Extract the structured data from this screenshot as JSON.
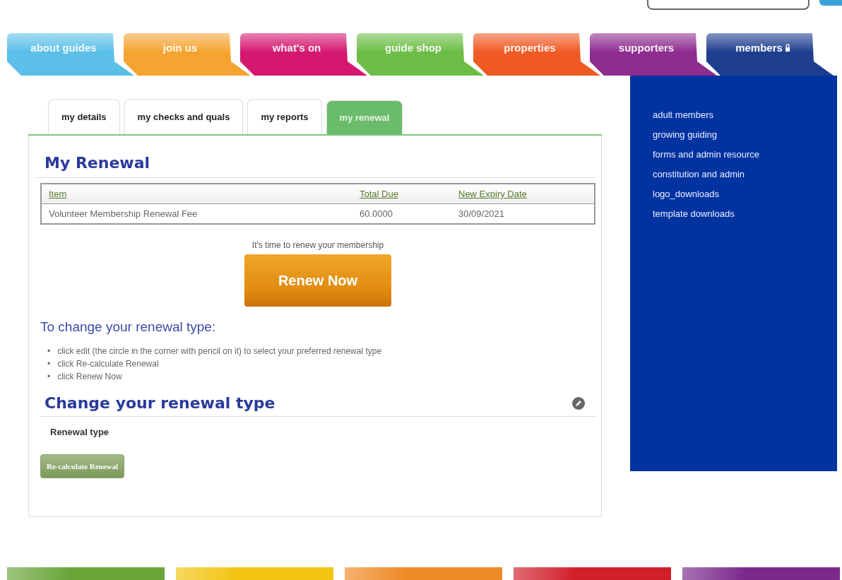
{
  "nav_tabs": [
    {
      "label": "about guides",
      "selected": false,
      "color": "#5bbfe8"
    },
    {
      "label": "join us",
      "selected": false,
      "color": "#f5a431"
    },
    {
      "label": "what's on",
      "selected": false,
      "color": "#d4186f"
    },
    {
      "label": "guide shop",
      "selected": false,
      "color": "#6cbd45"
    },
    {
      "label": "properties",
      "selected": false,
      "color": "#f05a24"
    },
    {
      "label": "supporters",
      "selected": false,
      "color": "#8e2c8f"
    },
    {
      "label": "members",
      "selected": true,
      "color": "#1e3f8f"
    }
  ],
  "page_tabs": [
    {
      "label": "my details",
      "selected": false
    },
    {
      "label": "my checks and quals",
      "selected": false
    },
    {
      "label": "my reports",
      "selected": false
    },
    {
      "label": "my renewal",
      "selected": true
    }
  ],
  "heading": "My Renewal",
  "table": {
    "columns": [
      "Item",
      "Total Due",
      "New Expiry Date"
    ],
    "rows": [
      [
        "Volunteer Membership Renewal Fee",
        "60.0000",
        "30/09/2021"
      ]
    ]
  },
  "renew_prompt": "It's time to renew your membership",
  "renew_button": "Renew Now",
  "instructions_title": "To change your renewal type:",
  "instructions": [
    {
      "bullet": "•",
      "text": "click edit (the circle in the corner with pencil on it) to select your preferred renewal type"
    },
    {
      "bullet": "•",
      "text": "click Re-calculate Renewal"
    },
    {
      "bullet": "•",
      "text": "click Renew Now"
    }
  ],
  "change_section": {
    "title": "Change your renewal type",
    "field_label": "Renewal type",
    "button": "Re-calculate Renewal"
  },
  "sidebar": {
    "items": [
      "adult members",
      "growing guiding",
      "forms and admin resource",
      "constitution and admin",
      "logo_downloads",
      "template downloads"
    ]
  },
  "footer_bars": [
    {
      "color": "#6aa53a"
    },
    {
      "color": "#f2c40f"
    },
    {
      "color": "#ee8a25"
    },
    {
      "color": "#d11f2a"
    },
    {
      "color": "#7b2a8c"
    }
  ]
}
